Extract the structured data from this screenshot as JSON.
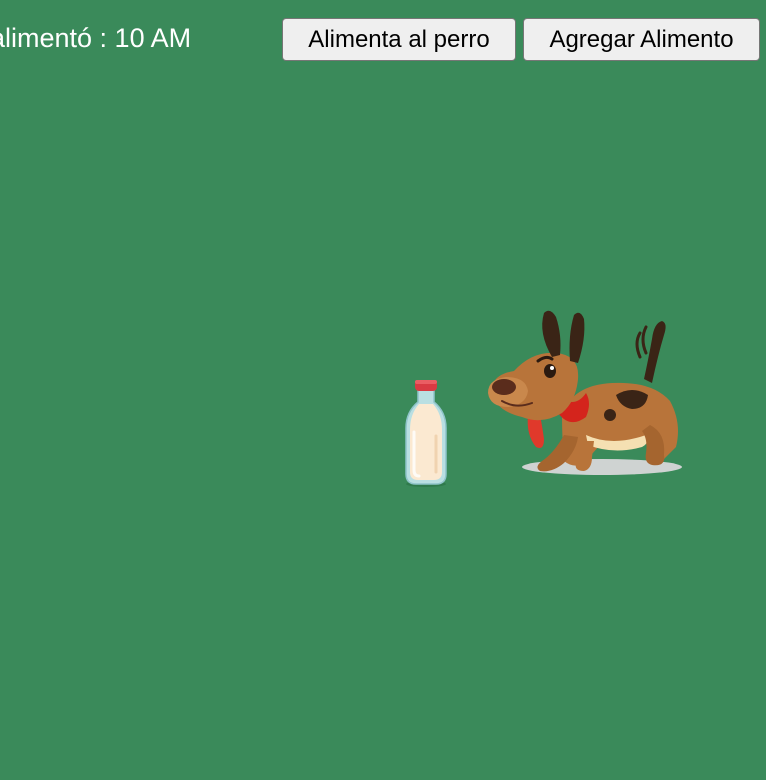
{
  "status": {
    "fed_text": "alimentó : 10 AM"
  },
  "toolbar": {
    "feed_label": "Alimenta al perro",
    "add_food_label": "Agregar Alimento"
  },
  "scene": {
    "background_color": "#3a8a5a",
    "items": [
      {
        "name": "milk-bottle-icon"
      },
      {
        "name": "dog-icon"
      }
    ]
  }
}
